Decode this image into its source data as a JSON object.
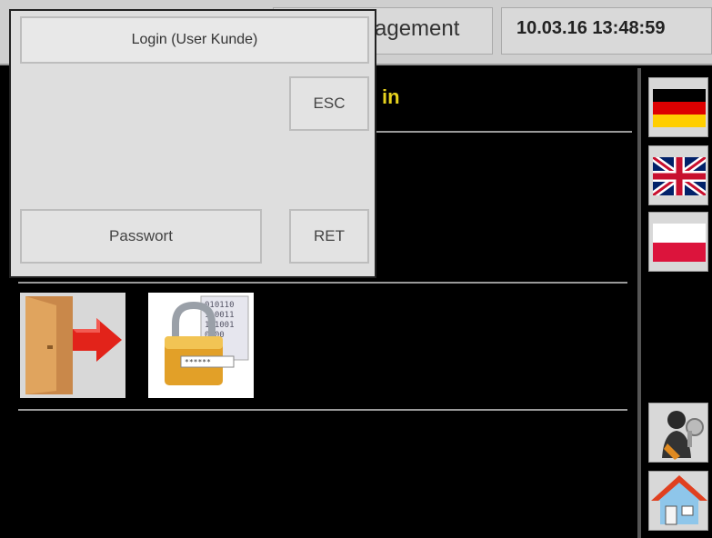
{
  "topbar": {
    "title": "agement",
    "datetime": "10.03.16 13:48:59"
  },
  "main": {
    "header": "in"
  },
  "dialog": {
    "title": "Login (User Kunde)",
    "esc_label": "ESC",
    "password_label": "Passwort",
    "ret_label": "RET"
  },
  "colors": {
    "header_text": "#e6d21e",
    "background": "#000000",
    "panel": "#dedede"
  },
  "icons": {
    "logout": "door-exit-icon",
    "password": "padlock-binary-icon",
    "lang_de": "flag-germany-icon",
    "lang_en": "flag-uk-icon",
    "lang_pl": "flag-poland-icon",
    "user_settings": "user-key-icon",
    "home": "home-icon"
  }
}
